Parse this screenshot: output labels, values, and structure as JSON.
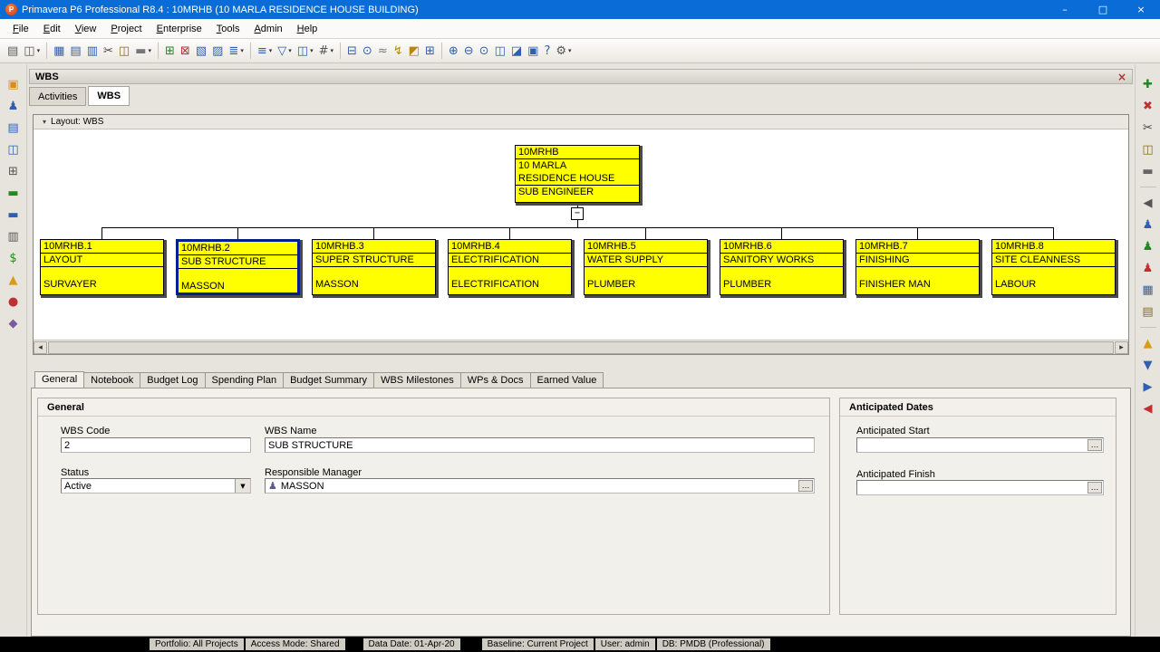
{
  "titlebar": {
    "app_icon": "P",
    "title": "Primavera P6 Professional R8.4 : 10MRHB (10 MARLA RESIDENCE HOUSE BUILDING)",
    "minimize": "–",
    "maximize": "□",
    "close": "×"
  },
  "menubar": {
    "items": [
      "File",
      "Edit",
      "View",
      "Project",
      "Enterprise",
      "Tools",
      "Admin",
      "Help"
    ]
  },
  "toolbar": {
    "caret_glyph": "▾",
    "icons": [
      {
        "name": "print-icon",
        "glyph": "▤",
        "color": "#5a5a5a"
      },
      {
        "name": "print-preview-icon",
        "glyph": "◫",
        "color": "#5a5a5a",
        "caret": true
      },
      {
        "sep": true
      },
      {
        "name": "open-layout-icon",
        "glyph": "▦",
        "color": "#2f5fae"
      },
      {
        "name": "table-view-icon",
        "glyph": "▤",
        "color": "#2f5fae"
      },
      {
        "name": "gantt-view-icon",
        "glyph": "▥",
        "color": "#2f5fae"
      },
      {
        "name": "cut-icon",
        "glyph": "✂",
        "color": "#444444"
      },
      {
        "name": "copy-icon",
        "glyph": "◫",
        "color": "#8a6d1e"
      },
      {
        "name": "paste-icon",
        "glyph": "▬",
        "color": "#777777",
        "caret": true
      },
      {
        "sep": true
      },
      {
        "name": "add-icon",
        "glyph": "⊞",
        "color": "#1f8a1f"
      },
      {
        "name": "delete-icon",
        "glyph": "⊠",
        "color": "#b23333"
      },
      {
        "name": "activity-network-icon",
        "glyph": "▧",
        "color": "#2f5fae"
      },
      {
        "name": "trace-logic-icon",
        "glyph": "▨",
        "color": "#2f5fae"
      },
      {
        "name": "resource-usage-icon",
        "glyph": "≣",
        "color": "#2f5fae",
        "caret": true
      },
      {
        "sep": true
      },
      {
        "name": "group-sort-icon",
        "glyph": "≡",
        "color": "#2f5fae",
        "caret": true
      },
      {
        "name": "filter-icon",
        "glyph": "▽",
        "color": "#2f5fae",
        "caret": true
      },
      {
        "name": "columns-icon",
        "glyph": "◫",
        "color": "#2f5fae",
        "caret": true
      },
      {
        "name": "row-numbers-icon",
        "glyph": "#",
        "color": "#555555",
        "caret": true
      },
      {
        "sep": true
      },
      {
        "name": "details-icon",
        "glyph": "⊟",
        "color": "#2f5fae"
      },
      {
        "name": "find-icon",
        "glyph": "⊙",
        "color": "#2f5fae"
      },
      {
        "name": "relationship-lines-icon",
        "glyph": "≈",
        "color": "#777777"
      },
      {
        "name": "schedule-icon",
        "glyph": "↯",
        "color": "#b8860b"
      },
      {
        "name": "progress-spotlight-icon",
        "glyph": "◩",
        "color": "#b8860b"
      },
      {
        "name": "resource-assign-icon",
        "glyph": "⊞",
        "color": "#2f5fae"
      },
      {
        "sep": true
      },
      {
        "name": "zoom-in-icon",
        "glyph": "⊕",
        "color": "#2f5fae"
      },
      {
        "name": "zoom-out-icon",
        "glyph": "⊖",
        "color": "#2f5fae"
      },
      {
        "name": "zoom-fit-icon",
        "glyph": "⊙",
        "color": "#2f5fae"
      },
      {
        "name": "timescale-icon",
        "glyph": "◫",
        "color": "#2f5fae"
      },
      {
        "name": "split-screen-icon",
        "glyph": "◪",
        "color": "#2f5fae"
      },
      {
        "name": "comments-icon",
        "glyph": "▣",
        "color": "#2f5fae"
      },
      {
        "name": "help-icon",
        "glyph": "?",
        "color": "#2f5fae"
      },
      {
        "name": "settings-icon",
        "glyph": "⚙",
        "color": "#555555",
        "caret": true
      }
    ]
  },
  "leftbar": {
    "icons": [
      {
        "name": "projects-icon",
        "glyph": "▣",
        "color": "#d98c1a"
      },
      {
        "name": "resources-icon",
        "glyph": "♟",
        "color": "#2f5fae"
      },
      {
        "name": "reports-icon",
        "glyph": "▤",
        "color": "#2f5fae"
      },
      {
        "name": "tracking-icon",
        "glyph": "◫",
        "color": "#2f5fae"
      },
      {
        "name": "wbs-icon",
        "glyph": "⊞",
        "color": "#555555"
      },
      {
        "name": "activities-icon",
        "glyph": "▬",
        "color": "#1f8a1f"
      },
      {
        "name": "assignments-icon",
        "glyph": "▬",
        "color": "#2f5fae"
      },
      {
        "name": "wps-docs-icon",
        "glyph": "▥",
        "color": "#555555"
      },
      {
        "name": "expenses-icon",
        "glyph": "$",
        "color": "#1f8a1f"
      },
      {
        "name": "thresholds-icon",
        "glyph": "▲",
        "color": "#d89c18"
      },
      {
        "name": "issues-icon",
        "glyph": "●",
        "color": "#c03030"
      },
      {
        "name": "risks-icon",
        "glyph": "◆",
        "color": "#7a5aa0"
      }
    ]
  },
  "rightbar": {
    "icons": [
      {
        "name": "add-icon",
        "glyph": "✚",
        "color": "#1f8a1f"
      },
      {
        "name": "delete-icon",
        "glyph": "✖",
        "color": "#c03030"
      },
      {
        "name": "cut-icon",
        "glyph": "✂",
        "color": "#444444"
      },
      {
        "name": "copy-icon",
        "glyph": "◫",
        "color": "#8a6d1e"
      },
      {
        "name": "paste-icon",
        "glyph": "▬",
        "color": "#666666"
      },
      {
        "sep": true
      },
      {
        "name": "collapse-panel-icon",
        "glyph": "◀",
        "color": "#555555"
      },
      {
        "name": "resources-icon",
        "glyph": "♟",
        "color": "#2f5fae"
      },
      {
        "name": "assign-resource-icon",
        "glyph": "♟",
        "color": "#1f8a1f"
      },
      {
        "name": "remove-resource-icon",
        "glyph": "♟",
        "color": "#c03030"
      },
      {
        "name": "activity-codes-icon",
        "glyph": "▦",
        "color": "#2f5fae"
      },
      {
        "name": "notebook-icon",
        "glyph": "▤",
        "color": "#8a6d1e"
      },
      {
        "sep": true
      },
      {
        "name": "move-up-icon",
        "glyph": "▲",
        "color": "#d89c18"
      },
      {
        "name": "move-down-icon",
        "glyph": "▼",
        "color": "#2f5fae"
      },
      {
        "name": "move-right-icon",
        "glyph": "▶",
        "color": "#2f5fae"
      },
      {
        "name": "move-left-icon",
        "glyph": "◀",
        "color": "#c03030"
      }
    ]
  },
  "wbs_view": {
    "panel_title": "WBS",
    "close_glyph": "×",
    "tabs": [
      {
        "label": "Activities"
      },
      {
        "label": "WBS"
      }
    ],
    "layout_bar": {
      "chevron": "▾",
      "label": "Layout: WBS"
    },
    "scroll": {
      "left": "◂",
      "right": "▸"
    }
  },
  "wbs_chart": {
    "type": "tree",
    "node_fill": "#ffff00",
    "selected_border": "#001e8c",
    "root": {
      "code": "10MRHB",
      "name_line1": "10 MARLA",
      "name_line2": "RESIDENCE HOUSE",
      "responsible": "SUB ENGINEER",
      "collapse_glyph": "−"
    },
    "children": [
      {
        "code": "10MRHB.1",
        "name": "LAYOUT",
        "responsible": "SURVAYER",
        "selected": false
      },
      {
        "code": "10MRHB.2",
        "name": "SUB STRUCTURE",
        "responsible": "MASSON",
        "selected": true
      },
      {
        "code": "10MRHB.3",
        "name": "SUPER STRUCTURE",
        "responsible": "MASSON",
        "selected": false
      },
      {
        "code": "10MRHB.4",
        "name": "ELECTRIFICATION",
        "responsible": "ELECTRIFICATION",
        "selected": false
      },
      {
        "code": "10MRHB.5",
        "name": "WATER SUPPLY",
        "responsible": "PLUMBER",
        "selected": false
      },
      {
        "code": "10MRHB.6",
        "name": "SANITORY WORKS",
        "responsible": "PLUMBER",
        "selected": false
      },
      {
        "code": "10MRHB.7",
        "name": "FINISHING",
        "responsible": "FINISHER MAN",
        "selected": false
      },
      {
        "code": "10MRHB.8",
        "name": "SITE CLEANNESS",
        "responsible": "LABOUR",
        "selected": false
      }
    ]
  },
  "details": {
    "tabs": [
      "General",
      "Notebook",
      "Budget Log",
      "Spending Plan",
      "Budget Summary",
      "WBS Milestones",
      "WPs & Docs",
      "Earned Value"
    ],
    "active_tab": "General",
    "general": {
      "title": "General",
      "wbs_code_label": "WBS Code",
      "wbs_code_value": "2",
      "wbs_name_label": "WBS Name",
      "wbs_name_value": "SUB STRUCTURE",
      "status_label": "Status",
      "status_value": "Active",
      "responsible_label": "Responsible Manager",
      "responsible_value": "MASSON",
      "resource_icon": "♟",
      "dropdown_glyph": "▼",
      "browse_glyph": "…"
    },
    "anticipated": {
      "title": "Anticipated Dates",
      "start_label": "Anticipated Start",
      "start_value": "",
      "finish_label": "Anticipated Finish",
      "finish_value": "",
      "browse_glyph": "…"
    }
  },
  "statusbar": {
    "segments": [
      "Portfolio: All Projects",
      "Access Mode: Shared",
      "Data Date: 01-Apr-20",
      "Baseline: Current Project",
      "User: admin",
      "DB: PMDB (Professional)"
    ]
  }
}
